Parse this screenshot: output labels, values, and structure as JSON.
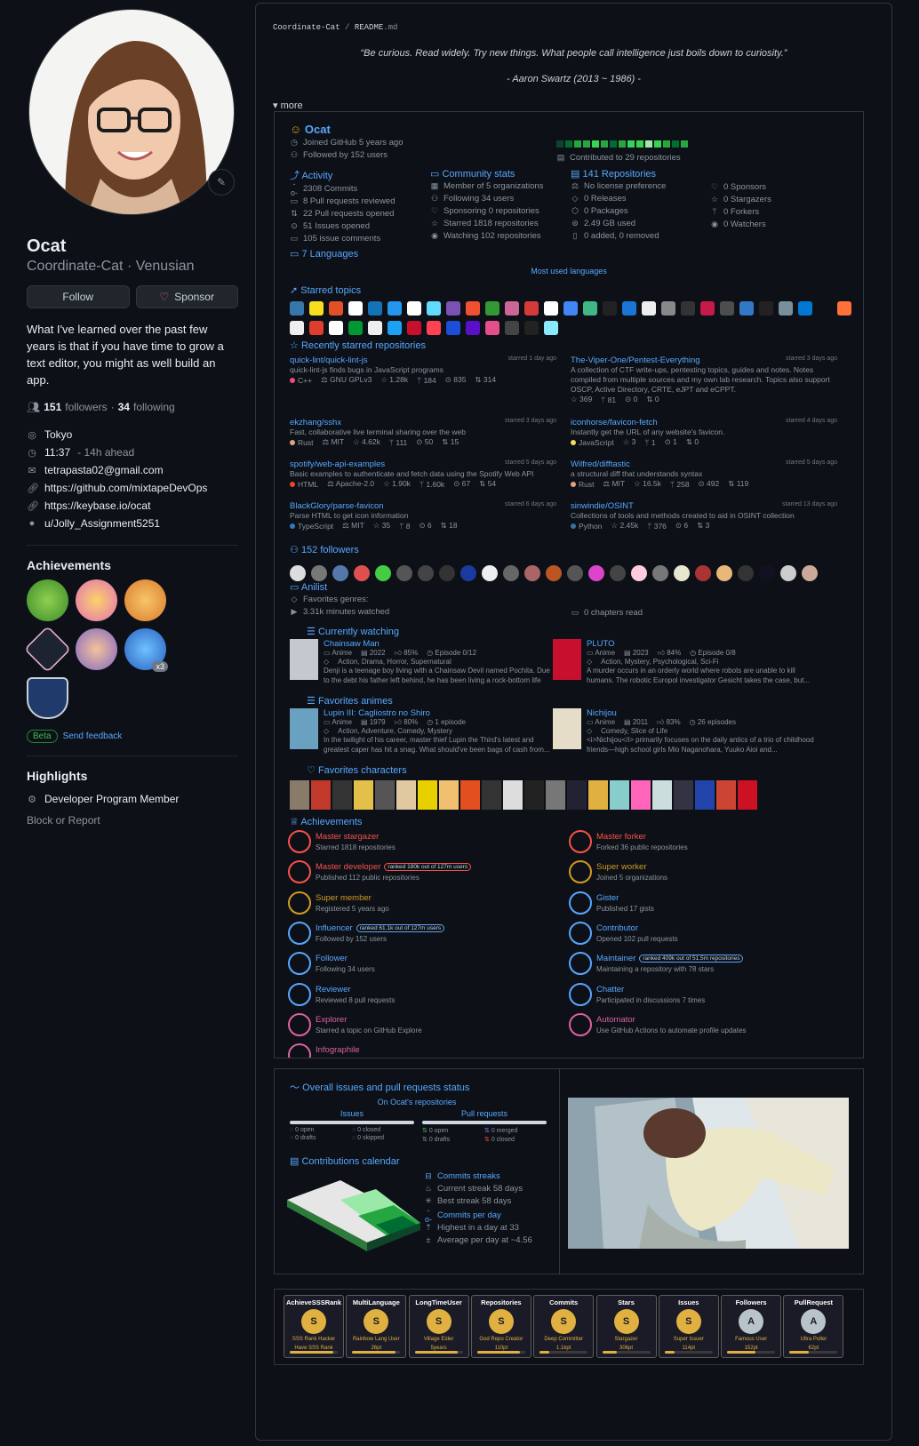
{
  "profile": {
    "name": "Ocat",
    "username": "Coordinate-Cat · Venusian",
    "follow_label": "Follow",
    "sponsor_label": "Sponsor",
    "bio": "What I've learned over the past few years is that if you have time to grow a text editor, you might as well build an app.",
    "followers_count": "151",
    "followers_label": "followers",
    "following_count": "34",
    "following_label": "following",
    "location": "Tokyo",
    "localtime": "11:37",
    "local_offset": "- 14h ahead",
    "email": "tetrapasta02@gmail.com",
    "links": [
      "https://github.com/mixtapeDevOps",
      "https://keybase.io/ocat",
      "u/Jolly_Assignment5251"
    ],
    "achievements_title": "Achievements",
    "achievement_multiplier": "x3",
    "beta_label": "Beta",
    "feedback_label": "Send feedback",
    "highlights_title": "Highlights",
    "highlight_item": "Developer Program Member",
    "block_report": "Block or Report"
  },
  "readme": {
    "crumb_user": "Coordinate-Cat",
    "crumb_sep": "/",
    "crumb_file": "README",
    "crumb_ext": ".md",
    "quote": "“Be curious. Read widely. Try new things. What people call intelligence just boils down to curiosity.”",
    "quote_author": "- Aaron Swartz (2013 ~ 1986) -",
    "more_label": "more"
  },
  "metrics": {
    "user": "Ocat",
    "joined": "Joined GitHub 5 years ago",
    "followed": "Followed by 152 users",
    "contributed": "Contributed to 29 repositories",
    "activity_title": "Activity",
    "activity": [
      "2308 Commits",
      "8 Pull requests reviewed",
      "22 Pull requests opened",
      "51 Issues opened",
      "105 issue comments"
    ],
    "community_title": "Community stats",
    "community": [
      "Member of 5 organizations",
      "Following 34 users",
      "Sponsoring 0 repositories",
      "Starred 1818 repositories",
      "Watching 102 repositories"
    ],
    "repos_title": "141 Repositories",
    "repos_a": [
      "No license preference",
      "0 Releases",
      "0 Packages",
      "2.49 GB used",
      "0 added, 0 removed"
    ],
    "repos_b": [
      "0 Sponsors",
      "0 Stargazers",
      "0 Forkers",
      "0 Watchers"
    ],
    "languages_title": "7 Languages",
    "most_used": "Most used languages",
    "topics_title": "Starred topics",
    "recent_title": "Recently starred repositories",
    "repos": [
      {
        "name": "quick-lint/quick-lint-js",
        "when": "starred 1 day ago",
        "desc": "quick-lint-js finds bugs in JavaScript programs",
        "lang": "C++",
        "lic": "GNU GPLv3",
        "stars": "1.28k",
        "forks": "184",
        "issues": "835",
        "prs": "314",
        "color": "#f34b7d"
      },
      {
        "name": "The-Viper-One/Pentest-Everything",
        "when": "starred 3 days ago",
        "desc": "A collection of CTF write-ups, pentesting topics, guides and notes. Notes compiled from multiple sources and my own lab research. Topics also support OSCP, Active Directory, CRTE, eJPT and eCPPT.",
        "lang": "",
        "lic": "",
        "stars": "369",
        "forks": "81",
        "issues": "0",
        "prs": "0",
        "color": ""
      },
      {
        "name": "ekzhang/sshx",
        "when": "starred 3 days ago",
        "desc": "Fast, collaborative live terminal sharing over the web",
        "lang": "Rust",
        "lic": "MIT",
        "stars": "4.62k",
        "forks": "111",
        "issues": "50",
        "prs": "15",
        "color": "#dea584"
      },
      {
        "name": "iconhorse/favicon-fetch",
        "when": "starred 4 days ago",
        "desc": "Instantly get the URL of any website's favicon.",
        "lang": "JavaScript",
        "lic": "",
        "stars": "3",
        "forks": "1",
        "issues": "1",
        "prs": "0",
        "color": "#f1e05a"
      },
      {
        "name": "spotify/web-api-examples",
        "when": "starred 5 days ago",
        "desc": "Basic examples to authenticate and fetch data using the Spotify Web API",
        "lang": "HTML",
        "lic": "Apache-2.0",
        "stars": "1.90k",
        "forks": "1.60k",
        "issues": "67",
        "prs": "54",
        "color": "#e34c26"
      },
      {
        "name": "Wilfred/difftastic",
        "when": "starred 5 days ago",
        "desc": "a structural diff that understands syntax",
        "lang": "Rust",
        "lic": "MIT",
        "stars": "16.5k",
        "forks": "258",
        "issues": "492",
        "prs": "119",
        "color": "#dea584"
      },
      {
        "name": "BlackGlory/parse-favicon",
        "when": "starred 6 days ago",
        "desc": "Parse HTML to get icon information",
        "lang": "TypeScript",
        "lic": "MIT",
        "stars": "35",
        "forks": "8",
        "issues": "6",
        "prs": "18",
        "color": "#3178c6"
      },
      {
        "name": "sinwindie/OSINT",
        "when": "starred 13 days ago",
        "desc": "Collections of tools and methods created to aid in OSINT collection",
        "lang": "Python",
        "lic": "",
        "stars": "2.45k",
        "forks": "376",
        "issues": "6",
        "prs": "3",
        "color": "#3572A5"
      }
    ],
    "followers_title": "152 followers",
    "anilist_title": "Anilist",
    "fav_genres": "Favorites genres:",
    "minutes": "3.31k minutes watched",
    "chapters": "0 chapters read",
    "watching_title": "Currently watching",
    "watching": [
      {
        "name": "Chainsaw Man",
        "type": "Anime",
        "year": "2022",
        "score": "85%",
        "ep": "Episode 0/12",
        "genres": "Action, Drama, Horror, Supernatural",
        "desc": "Denji is a teenage boy living with a Chainsaw Devil named Pochita. Due to the debt his father left behind, he has been living a rock-bottom life"
      },
      {
        "name": "PLUTO",
        "type": "Anime",
        "year": "2023",
        "score": "84%",
        "ep": "Episode 0/8",
        "genres": "Action, Mystery, Psychological, Sci-Fi",
        "desc": "A murder occurs in an orderly world where robots are unable to kill humans. The robotic Europol investigator Gesicht takes the case, but..."
      }
    ],
    "fav_anime_title": "Favorites animes",
    "fav_anime": [
      {
        "name": "Lupin III: Cagliostro no Shiro",
        "type": "Anime",
        "year": "1979",
        "score": "80%",
        "ep": "1 episode",
        "genres": "Action, Adventure, Comedy, Mystery",
        "desc": "In the twilight of his career, master thief Lupin the Third's latest and greatest caper has hit a snag. What should've been bags of cash from..."
      },
      {
        "name": "Nichijou",
        "type": "Anime",
        "year": "2011",
        "score": "83%",
        "ep": "26 episodes",
        "genres": "Comedy, Slice of Life",
        "desc": "<i>Nichijou</i> primarily focuses on the daily antics of a trio of childhood friends—high school girls Mio Naganohara, Yuuko Aioi and..."
      }
    ],
    "fav_chars_title": "Favorites characters",
    "achievements_title": "Achievements",
    "achievements": [
      {
        "name": "Master stargazer",
        "sub": "Starred 1818 repositories",
        "rank": "",
        "color": "#f85149"
      },
      {
        "name": "Master forker",
        "sub": "Forked 36 public repositories",
        "rank": "",
        "color": "#f85149"
      },
      {
        "name": "Master developer",
        "sub": "Published 112 public repositories",
        "rank": "ranked 180k out of 127m users",
        "color": "#f85149"
      },
      {
        "name": "Super worker",
        "sub": "Joined 5 organizations",
        "rank": "",
        "color": "#d29922"
      },
      {
        "name": "Super member",
        "sub": "Registered 5 years ago",
        "rank": "",
        "color": "#d29922"
      },
      {
        "name": "Gister",
        "sub": "Published 17 gists",
        "rank": "",
        "color": "#58a6ff"
      },
      {
        "name": "Influencer",
        "sub": "Followed by 152 users",
        "rank": "ranked 61.1k out of 127m users",
        "color": "#58a6ff"
      },
      {
        "name": "Contributor",
        "sub": "Opened 102 pull requests",
        "rank": "",
        "color": "#58a6ff"
      },
      {
        "name": "Follower",
        "sub": "Following 34 users",
        "rank": "",
        "color": "#58a6ff"
      },
      {
        "name": "Maintainer",
        "sub": "Maintaining a repository with 78 stars",
        "rank": "ranked 409k out of 51.5m repositories",
        "color": "#58a6ff"
      },
      {
        "name": "Reviewer",
        "sub": "Reviewed 8 pull requests",
        "rank": "",
        "color": "#58a6ff"
      },
      {
        "name": "Chatter",
        "sub": "Participated in discussions 7 times",
        "rank": "",
        "color": "#58a6ff"
      },
      {
        "name": "Explorer",
        "sub": "Starred a topic on GitHub Explore",
        "rank": "",
        "color": "#db61a2"
      },
      {
        "name": "Automator",
        "sub": "Use GitHub Actions to automate profile updates",
        "rank": "",
        "color": "#db61a2"
      },
      {
        "name": "Infographile",
        "sub": "",
        "rank": "",
        "color": "#db61a2"
      }
    ]
  },
  "status": {
    "title": "Overall issues and pull requests status",
    "on_repos": "On Ocat's repositories",
    "issues_label": "Issues",
    "prs_label": "Pull requests",
    "issues": [
      "0 open",
      "0 closed",
      "0 drafts",
      "0 skipped"
    ],
    "prs": [
      "0 open",
      "0 merged",
      "0 drafts",
      "0 closed"
    ],
    "calendar_title": "Contributions calendar",
    "streaks_title": "Commits streaks",
    "current": "Current streak 58 days",
    "best": "Best streak 58 days",
    "perday_title": "Commits per day",
    "highest": "Highest in a day at 33",
    "average": "Average per day at ~4.56"
  },
  "trophies": [
    {
      "title": "AchieveSSSRank",
      "rank": "S",
      "l1": "SSS Rank Hacker",
      "l2": "Have SSS Rank",
      "progress": 0.9,
      "color": "#e0b040"
    },
    {
      "title": "MultiLanguage",
      "rank": "S",
      "l1": "Rainbow Lang User",
      "l2": "26pt",
      "progress": 0.9,
      "color": "#e0b040"
    },
    {
      "title": "LongTimeUser",
      "rank": "S",
      "l1": "Village Elder",
      "l2": "5years",
      "progress": 0.9,
      "color": "#e0b040"
    },
    {
      "title": "Repositories",
      "rank": "S",
      "l1": "God Repo Creator",
      "l2": "110pt",
      "progress": 0.9,
      "color": "#e0b040"
    },
    {
      "title": "Commits",
      "rank": "S",
      "l1": "Deep Committer",
      "l2": "1.1kpt",
      "progress": 0.2,
      "color": "#e0b040"
    },
    {
      "title": "Stars",
      "rank": "S",
      "l1": "Stargazer",
      "l2": "306pt",
      "progress": 0.3,
      "color": "#e0b040"
    },
    {
      "title": "Issues",
      "rank": "S",
      "l1": "Super Issuer",
      "l2": "114pt",
      "progress": 0.2,
      "color": "#e0b040"
    },
    {
      "title": "Followers",
      "rank": "A",
      "l1": "Famous User",
      "l2": "152pt",
      "progress": 0.6,
      "color": "#b8c4c9"
    },
    {
      "title": "PullRequest",
      "rank": "A",
      "l1": "Ultra Puller",
      "l2": "62pt",
      "progress": 0.4,
      "color": "#b8c4c9"
    }
  ]
}
